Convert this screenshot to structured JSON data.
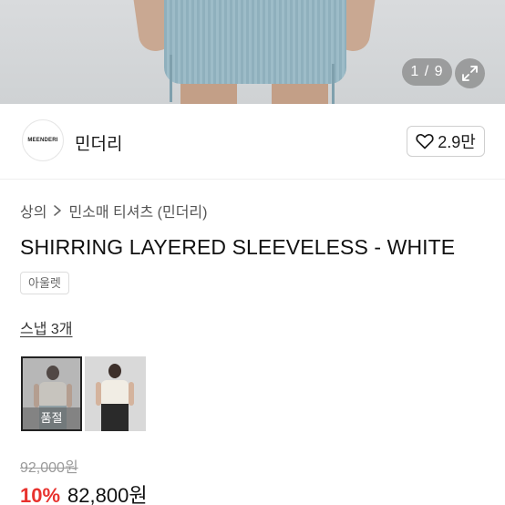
{
  "gallery": {
    "counter": "1 / 9",
    "expand_icon": "expand-icon"
  },
  "store": {
    "logo_text": "MEENDERI",
    "name": "민더리",
    "like_count": "2.9만",
    "like_icon": "heart-outline-icon"
  },
  "breadcrumb": {
    "items": [
      "상의",
      "민소매 티셔츠 (민더리)"
    ],
    "separator_icon": "chevron-right-icon"
  },
  "product": {
    "title": "SHIRRING LAYERED SLEEVELESS - WHITE",
    "badge": "아울렛"
  },
  "snap": {
    "label": "스냅 3개"
  },
  "thumbnails": [
    {
      "overlay": "품절"
    },
    {
      "overlay": ""
    }
  ],
  "price": {
    "original": "92,000원",
    "discount": "10%",
    "sale": "82,800원",
    "discount_color": "#e8322e"
  }
}
